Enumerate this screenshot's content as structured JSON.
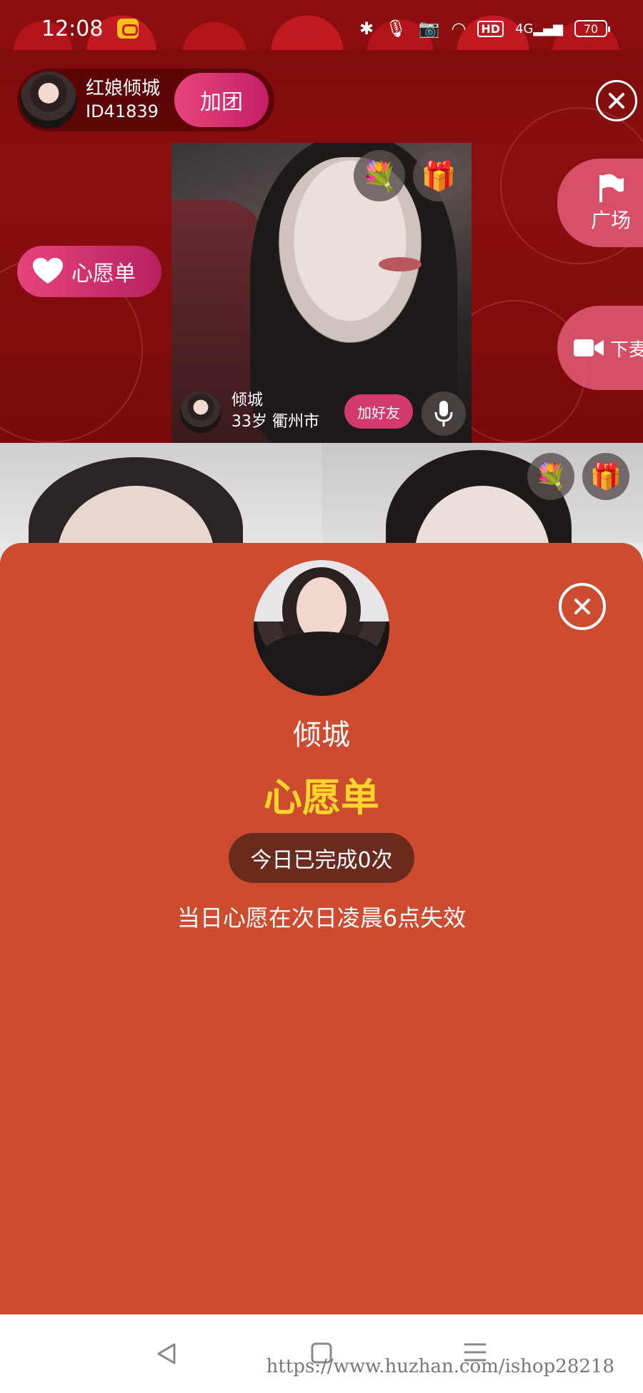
{
  "status_bar": {
    "time": "12:08",
    "battery": "70",
    "hd_label": "HD",
    "network_label": "4G"
  },
  "host": {
    "name": "红娘倾城",
    "id": "ID41839",
    "join_label": "加团"
  },
  "side": {
    "wishlist_label": "心愿单",
    "plaza_label": "广场",
    "mic_off_label": "下麦"
  },
  "main_video": {
    "user_name": "倾城",
    "user_meta": "33岁 衢州市",
    "add_friend_label": "加好友"
  },
  "sheet": {
    "username": "倾城",
    "title": "心愿单",
    "completed": "今日已完成0次",
    "expire_note": "当日心愿在次日凌晨6点失效"
  },
  "watermark": "https://www.huzhan.com/ishop28218",
  "colors": {
    "stage_bg": "#8a0f10",
    "sheet_bg": "#cd4b2f",
    "title_yellow": "#ffd52b",
    "pink_button": "#d13a6a"
  },
  "icons": [
    "close-icon",
    "flag-icon",
    "video-camera-icon",
    "heart-icon",
    "flower-gift-icon",
    "gift-box-icon",
    "mic-icon",
    "back-icon",
    "home-icon",
    "menu-icon"
  ]
}
